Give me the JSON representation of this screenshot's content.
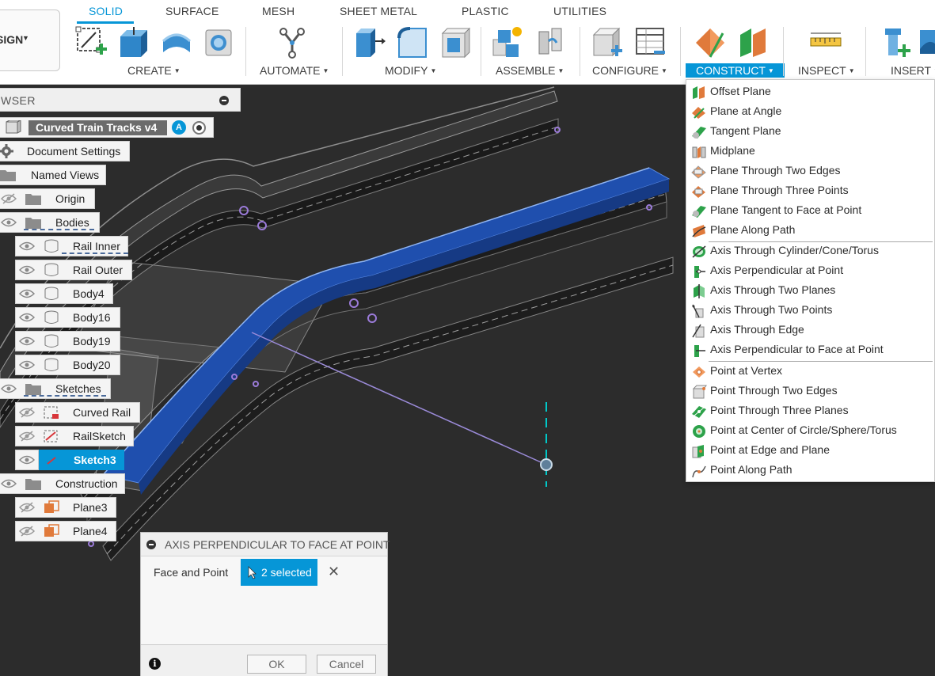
{
  "toolbar": {
    "workspace": "SIGN",
    "tabs": [
      {
        "label": "SOLID",
        "active": true
      },
      {
        "label": "SURFACE"
      },
      {
        "label": "MESH"
      },
      {
        "label": "SHEET METAL"
      },
      {
        "label": "PLASTIC"
      },
      {
        "label": "UTILITIES"
      }
    ],
    "groups": {
      "create": "CREATE",
      "automate": "AUTOMATE",
      "modify": "MODIFY",
      "assemble": "ASSEMBLE",
      "configure": "CONFIGURE",
      "construct": "CONSTRUCT",
      "inspect": "INSPECT",
      "insert": "INSERT"
    }
  },
  "browser": {
    "title": "WSER",
    "root": "Curved Train Tracks v4",
    "root_badge": "A",
    "nodes": {
      "document_settings": "Document Settings",
      "named_views": "Named Views",
      "origin": "Origin",
      "bodies": "Bodies",
      "rail_inner": "Rail Inner",
      "rail_outer": "Rail Outer",
      "body4": "Body4",
      "body16": "Body16",
      "body19": "Body19",
      "body20": "Body20",
      "sketches": "Sketches",
      "curved_rail": "Curved Rail",
      "railsketch": "RailSketch",
      "sketch3": "Sketch3",
      "construction": "Construction",
      "plane3": "Plane3",
      "plane4": "Plane4"
    }
  },
  "construct_menu": {
    "planes": [
      "Offset Plane",
      "Plane at Angle",
      "Tangent Plane",
      "Midplane",
      "Plane Through Two Edges",
      "Plane Through Three Points",
      "Plane Tangent to Face at Point",
      "Plane Along Path"
    ],
    "axes": [
      "Axis Through Cylinder/Cone/Torus",
      "Axis Perpendicular at Point",
      "Axis Through Two Planes",
      "Axis Through Two Points",
      "Axis Through Edge",
      "Axis Perpendicular to Face at Point"
    ],
    "points": [
      "Point at Vertex",
      "Point Through Two Edges",
      "Point Through Three Planes",
      "Point at Center of Circle/Sphere/Torus",
      "Point at Edge and Plane",
      "Point Along Path"
    ]
  },
  "dialog": {
    "title": "AXIS PERPENDICULAR TO FACE AT POINT",
    "field_label": "Face and Point",
    "selection": "2 selected",
    "ok": "OK",
    "cancel": "Cancel",
    "info": "i"
  },
  "colors": {
    "accent": "#0696d7",
    "canvas": "#2c2c2c",
    "selected_face": "#1f4fae",
    "sketch_line": "#9b8bd9",
    "axis": "#00c8c8"
  }
}
